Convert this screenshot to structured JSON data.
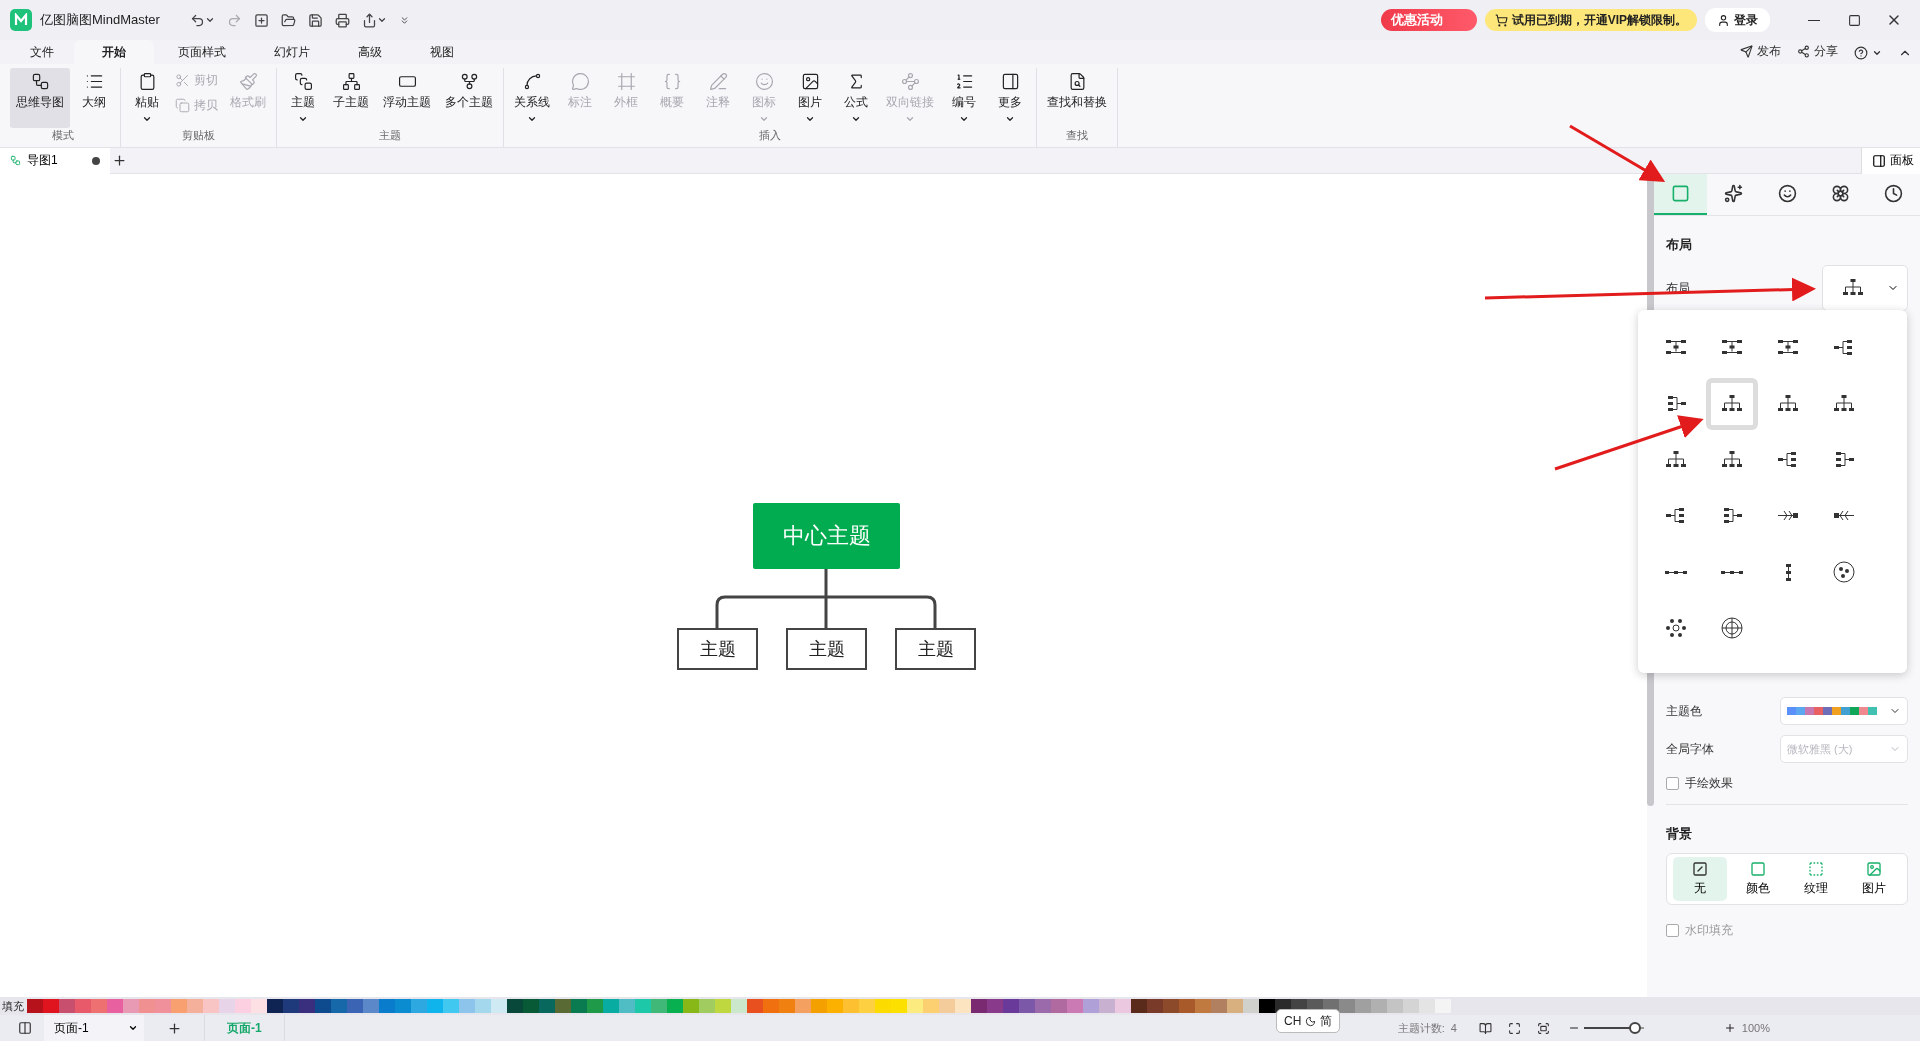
{
  "app": {
    "title": "亿图脑图MindMaster"
  },
  "promo": {
    "event": "优惠活动",
    "trial": "试用已到期，开通VIP解锁限制。",
    "login": "登录"
  },
  "header_actions": [
    "发布",
    "分享"
  ],
  "menu_tabs": [
    {
      "label": "文件",
      "selected": false
    },
    {
      "label": "开始",
      "selected": true
    },
    {
      "label": "页面样式",
      "selected": false
    },
    {
      "label": "幻灯片",
      "selected": false
    },
    {
      "label": "高级",
      "selected": false
    },
    {
      "label": "视图",
      "selected": false
    }
  ],
  "ribbon_groups": [
    {
      "title": "模式",
      "items": [
        {
          "label": "思维导图",
          "kind": "large",
          "selected": true,
          "disabled": false,
          "dropdown": false
        },
        {
          "label": "大纲",
          "kind": "large",
          "selected": false,
          "disabled": false,
          "dropdown": false
        }
      ]
    },
    {
      "title": "剪贴板",
      "items": [
        {
          "label": "粘贴",
          "kind": "large",
          "disabled": false,
          "dropdown": true
        },
        {
          "label": "剪切",
          "kind": "small",
          "disabled": true,
          "dropdown": false
        },
        {
          "label": "拷贝",
          "kind": "small",
          "disabled": true,
          "dropdown": false
        },
        {
          "label": "格式刷",
          "kind": "large",
          "disabled": true,
          "dropdown": false
        }
      ]
    },
    {
      "title": "主题",
      "items": [
        {
          "label": "主题",
          "kind": "large",
          "disabled": false,
          "dropdown": true
        },
        {
          "label": "子主题",
          "kind": "large",
          "disabled": false,
          "dropdown": false
        },
        {
          "label": "浮动主题",
          "kind": "large",
          "disabled": false,
          "dropdown": false
        },
        {
          "label": "多个主题",
          "kind": "large",
          "disabled": false,
          "dropdown": false
        }
      ]
    },
    {
      "title": "插入",
      "items": [
        {
          "label": "关系线",
          "kind": "large",
          "disabled": false,
          "dropdown": true
        },
        {
          "label": "标注",
          "kind": "large",
          "disabled": true,
          "dropdown": false
        },
        {
          "label": "外框",
          "kind": "large",
          "disabled": true,
          "dropdown": false
        },
        {
          "label": "概要",
          "kind": "large",
          "disabled": true,
          "dropdown": false
        },
        {
          "label": "注释",
          "kind": "large",
          "disabled": true,
          "dropdown": false
        },
        {
          "label": "图标",
          "kind": "large",
          "disabled": true,
          "dropdown": true
        },
        {
          "label": "图片",
          "kind": "large",
          "disabled": false,
          "dropdown": true
        },
        {
          "label": "公式",
          "kind": "large",
          "disabled": false,
          "dropdown": true
        },
        {
          "label": "双向链接",
          "kind": "large",
          "disabled": true,
          "dropdown": true
        },
        {
          "label": "编号",
          "kind": "large",
          "disabled": false,
          "dropdown": true
        },
        {
          "label": "更多",
          "kind": "large",
          "disabled": false,
          "dropdown": true
        }
      ]
    },
    {
      "title": "查找",
      "items": [
        {
          "label": "查找和替换",
          "kind": "large",
          "disabled": false,
          "dropdown": false
        }
      ]
    }
  ],
  "document_tabs": [
    {
      "label": "导图1",
      "selected": true,
      "unsaved": true
    }
  ],
  "panel_toggle": "面板",
  "canvas": {
    "central_topic": "中心主题",
    "subtopics": [
      "主题",
      "主题",
      "主题"
    ]
  },
  "side_panel": {
    "tabs": [
      {
        "selected": true
      },
      {
        "selected": false
      },
      {
        "selected": false
      },
      {
        "selected": false
      },
      {
        "selected": false
      }
    ],
    "layout_heading": "布局",
    "layout_label": "布局",
    "layout_options": [
      {
        "selected": false
      },
      {
        "selected": false
      },
      {
        "selected": false
      },
      {
        "selected": false
      },
      {
        "selected": false
      },
      {
        "selected": true
      },
      {
        "selected": false
      },
      {
        "selected": false
      },
      {
        "selected": false
      },
      {
        "selected": false
      },
      {
        "selected": false
      },
      {
        "selected": false
      },
      {
        "selected": false
      },
      {
        "selected": false
      },
      {
        "selected": false
      },
      {
        "selected": false
      },
      {
        "selected": false
      },
      {
        "selected": false
      },
      {
        "selected": false
      },
      {
        "selected": false
      },
      {
        "selected": false
      },
      {
        "selected": false
      }
    ],
    "theme_color_label": "主题色",
    "theme_colors": [
      {
        "color": "#5b8ff9"
      },
      {
        "color": "#5ba8f0"
      },
      {
        "color": "#c878b0"
      },
      {
        "color": "#e86060"
      },
      {
        "color": "#6e6eb8"
      },
      {
        "color": "#f0a020"
      },
      {
        "color": "#40a0d0"
      },
      {
        "color": "#10a858"
      },
      {
        "color": "#f08890"
      },
      {
        "color": "#40c0b0"
      }
    ],
    "font_label": "全局字体",
    "font_field": {
      "value": "微软雅黑 (大)",
      "disabled": true
    },
    "hand_drawn": {
      "label": "手绘效果",
      "checked": false
    },
    "background_heading": "背景",
    "background_options": [
      {
        "label": "无",
        "selected": true
      },
      {
        "label": "颜色",
        "selected": false
      },
      {
        "label": "纹理",
        "selected": false
      },
      {
        "label": "图片",
        "selected": false
      }
    ],
    "watermark_fill": {
      "label": "水印填充",
      "checked": false
    }
  },
  "palette": {
    "label": "填充",
    "colors": [
      {
        "color": "#b5121b"
      },
      {
        "color": "#e0141e"
      },
      {
        "color": "#c8506e"
      },
      {
        "color": "#e85a6a"
      },
      {
        "color": "#ee7070"
      },
      {
        "color": "#e860a0"
      },
      {
        "color": "#e89ab4"
      },
      {
        "color": "#f09090"
      },
      {
        "color": "#f0909a"
      },
      {
        "color": "#f8a070"
      },
      {
        "color": "#f4b09a"
      },
      {
        "color": "#f8c4c4"
      },
      {
        "color": "#e8d4e8"
      },
      {
        "color": "#fcd0e0"
      },
      {
        "color": "#fce0e4"
      },
      {
        "color": "#102454"
      },
      {
        "color": "#1f3a7a"
      },
      {
        "color": "#3a2e7e"
      },
      {
        "color": "#0e4a8e"
      },
      {
        "color": "#1668a8"
      },
      {
        "color": "#3c64b4"
      },
      {
        "color": "#5a88c8"
      },
      {
        "color": "#0a7ccc"
      },
      {
        "color": "#0c8cd0"
      },
      {
        "color": "#2ea8e0"
      },
      {
        "color": "#10b4ec"
      },
      {
        "color": "#40c8f0"
      },
      {
        "color": "#8cc4ec"
      },
      {
        "color": "#a4d8ec"
      },
      {
        "color": "#d0eaf4"
      },
      {
        "color": "#08483a"
      },
      {
        "color": "#085a36"
      },
      {
        "color": "#08685e"
      },
      {
        "color": "#5a6a34"
      },
      {
        "color": "#0a7a50"
      },
      {
        "color": "#1e9a48"
      },
      {
        "color": "#08aca0"
      },
      {
        "color": "#50bcc4"
      },
      {
        "color": "#1cc8a8"
      },
      {
        "color": "#40b878"
      },
      {
        "color": "#08b050"
      },
      {
        "color": "#88b818"
      },
      {
        "color": "#a0cc60"
      },
      {
        "color": "#c0d840"
      },
      {
        "color": "#cce8cc"
      },
      {
        "color": "#e85020"
      },
      {
        "color": "#f07010"
      },
      {
        "color": "#f08010"
      },
      {
        "color": "#f4a060"
      },
      {
        "color": "#f4a000"
      },
      {
        "color": "#fcb000"
      },
      {
        "color": "#fcc030"
      },
      {
        "color": "#fcd040"
      },
      {
        "color": "#fcdc00"
      },
      {
        "color": "#fce000"
      },
      {
        "color": "#fcec80"
      },
      {
        "color": "#fcd070"
      },
      {
        "color": "#f4cc9c"
      },
      {
        "color": "#fce4c0"
      },
      {
        "color": "#7a2a70"
      },
      {
        "color": "#8a3a8a"
      },
      {
        "color": "#6a3a9a"
      },
      {
        "color": "#7c58a8"
      },
      {
        "color": "#9a6aaa"
      },
      {
        "color": "#b06aa0"
      },
      {
        "color": "#cc7ab4"
      },
      {
        "color": "#b0a0d8"
      },
      {
        "color": "#c8b0d0"
      },
      {
        "color": "#ecc8e0"
      },
      {
        "color": "#5a2a1a"
      },
      {
        "color": "#7a3a2a"
      },
      {
        "color": "#8c4a2a"
      },
      {
        "color": "#a85a2a"
      },
      {
        "color": "#c07a40"
      },
      {
        "color": "#b08060"
      },
      {
        "color": "#d8b080"
      },
      {
        "color": "#d0d0cc"
      },
      {
        "color": "#000000"
      },
      {
        "color": "#2a2a2a"
      },
      {
        "color": "#444444"
      },
      {
        "color": "#5a5a5a"
      },
      {
        "color": "#707070"
      },
      {
        "color": "#8a8a8a"
      },
      {
        "color": "#a0a0a0"
      },
      {
        "color": "#b0b0b0"
      },
      {
        "color": "#c4c4c4"
      },
      {
        "color": "#d4d4d4"
      },
      {
        "color": "#e4e4e4"
      },
      {
        "color": "#f4f4f4"
      }
    ]
  },
  "status_bar": {
    "page_select": "页面-1",
    "page_tabs": [
      {
        "label": "页面-1",
        "selected": true
      }
    ],
    "topic_count_label": "主题计数:",
    "topic_count": "4",
    "zoom_slider": {
      "level": 0.85
    },
    "zoom": "100%"
  },
  "ime": {
    "lang": "CH",
    "mode": "简"
  }
}
